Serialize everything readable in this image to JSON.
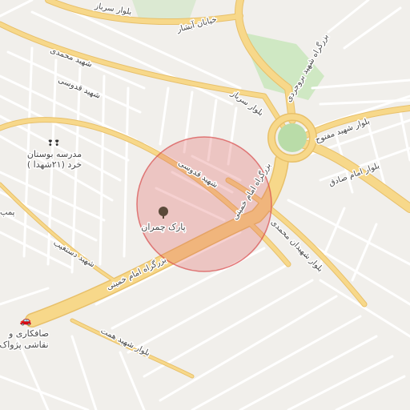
{
  "map": {
    "road_labels": [
      "بلوار سرباز",
      "خیابان آبشار",
      "بزرگراه شهید بروجردی",
      "شهید محمدی",
      "شهید قدوسی",
      "بلوار سرباز",
      "بلوار شهید مفتوح",
      "بلوار امام صادق",
      "شهید قدوسی",
      "بزرگراه امام خمینی",
      "بلوار شهیدان محمدی",
      "شهید دستغیب",
      "بزرگراه امام خمینی",
      "بلوار شهید همت"
    ],
    "pois": [
      {
        "name": "پارک چمران",
        "icon": "tree-icon"
      },
      {
        "name": "مدرسه بوستان خرد (۲۱شهدا)",
        "line1": "مدرسه بوستان",
        "line2": "خرد (۲۱شهدا )",
        "icon": "school-icon"
      },
      {
        "name": "صافکاری و نقاشی پژواک",
        "line1": "صافکاری و",
        "line2": "نقاشی پژواک",
        "icon": "car-icon"
      }
    ],
    "edge_fragments": [
      "پمپ"
    ],
    "highlight": {
      "type": "circle",
      "color": "#e05a5a"
    },
    "colors": {
      "background": "#f1efeb",
      "major_road": "#f7d88a",
      "major_road_casing": "#e8c06a",
      "minor_road": "#ffffff",
      "park": "#cfe8c3",
      "roundabout": "#b9dca8"
    }
  }
}
